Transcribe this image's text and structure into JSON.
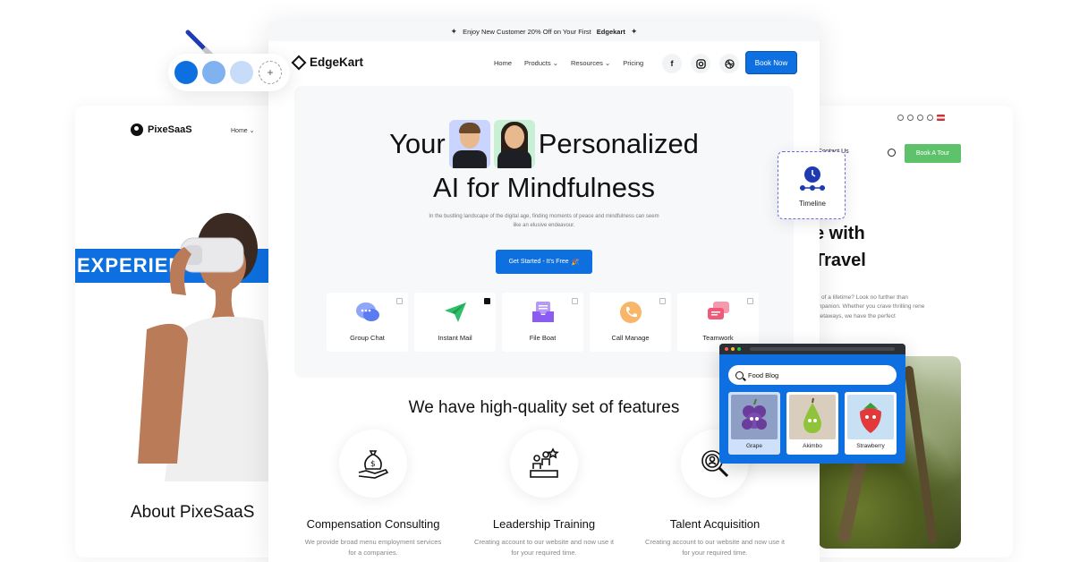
{
  "pixesaas": {
    "logo": "PixeSaaS",
    "nav_home": "Home",
    "band_text": "EXPERIEN",
    "about_title": "About PixeSaaS"
  },
  "travel": {
    "contact": "Contact Us",
    "book_btn": "Book A Tour",
    "heading_line1": "e with",
    "heading_line2": "Travel",
    "paragraph": "y of a lifetime? Look no further than mpanion. Whether you crave thrilling rene getaways, we have the perfect"
  },
  "edgekart": {
    "topbar_text": "Enjoy New Customer 20% Off on Your First",
    "topbar_brand": "Edgekart",
    "logo": "EdgeKart",
    "nav": [
      "Home",
      "Products",
      "Resources",
      "Pricing"
    ],
    "book_btn": "Book Now",
    "social": [
      "facebook-icon",
      "instagram-icon",
      "dribbble-icon"
    ],
    "hero": {
      "line1_a": "Your",
      "line1_b": "Personalized",
      "line2": "AI for Mindfulness",
      "subtitle": "In the bustling landscape of the digital age, finding moments of peace and mindfulness can seem like an elusive endeavour.",
      "cta": "Get Started - It's Free"
    },
    "tiles": [
      {
        "label": "Group Chat",
        "checked": false,
        "color": "#6c8cf5"
      },
      {
        "label": "Instant Mail",
        "checked": true,
        "color": "#2fbf6a"
      },
      {
        "label": "File Boat",
        "checked": false,
        "color": "#8a5cf0"
      },
      {
        "label": "Call Manage",
        "checked": false,
        "color": "#f5a04a"
      },
      {
        "label": "Teamwork",
        "checked": false,
        "color": "#f05a7a"
      }
    ],
    "features_title": "We have high-quality set of features",
    "features": [
      {
        "title": "Compensation Consulting",
        "desc": "We provide broad menu employment services for a companies."
      },
      {
        "title": "Leadership Training",
        "desc": "Creating account to our website and now use it for your required time."
      },
      {
        "title": "Talent Acquisition",
        "desc": "Creating account to our website and now use it for your required time."
      }
    ]
  },
  "palette": {
    "swatches": [
      "#0d6fe0",
      "#7fb2ef",
      "#c7dcf8"
    ],
    "add_label": "+"
  },
  "timeline": {
    "label": "Timeline",
    "color": "#1f3bb3"
  },
  "food_blog": {
    "search": "Food Blog",
    "items": [
      {
        "name": "Grape",
        "color": "#6a3d9a",
        "selected": true
      },
      {
        "name": "Akimbo",
        "color": "#8fc43a",
        "selected": false
      },
      {
        "name": "Strawberry",
        "color": "#e23a3a",
        "selected": false
      }
    ]
  }
}
